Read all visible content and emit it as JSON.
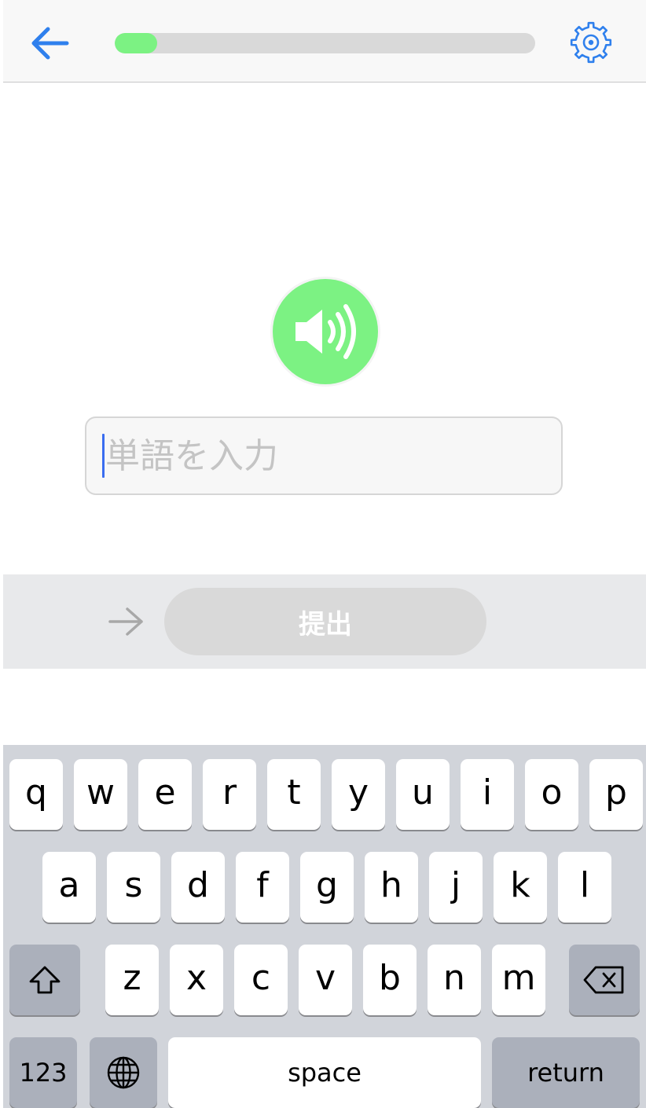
{
  "progress": {
    "value": 0.1
  },
  "input": {
    "placeholder": "単語を入力",
    "value": ""
  },
  "submit": {
    "label": "提出"
  },
  "keyboard": {
    "row1": [
      "q",
      "w",
      "e",
      "r",
      "t",
      "y",
      "u",
      "i",
      "o",
      "p"
    ],
    "row2": [
      "a",
      "s",
      "d",
      "f",
      "g",
      "h",
      "j",
      "k",
      "l"
    ],
    "row3": [
      "z",
      "x",
      "c",
      "v",
      "b",
      "n",
      "m"
    ],
    "numbers_label": "123",
    "space_label": "space",
    "return_label": "return"
  },
  "colors": {
    "accent_blue": "#2f80ed",
    "progress_green": "#7cf283",
    "speaker_green": "#7cf283",
    "submit_disabled": "#d9d9d9"
  },
  "icons": {
    "back": "arrow-left-icon",
    "settings": "gear-icon",
    "speaker": "speaker-volume-icon",
    "next": "arrow-right-icon",
    "shift": "shift-arrow-icon",
    "globe": "globe-icon",
    "delete": "backspace-icon"
  }
}
